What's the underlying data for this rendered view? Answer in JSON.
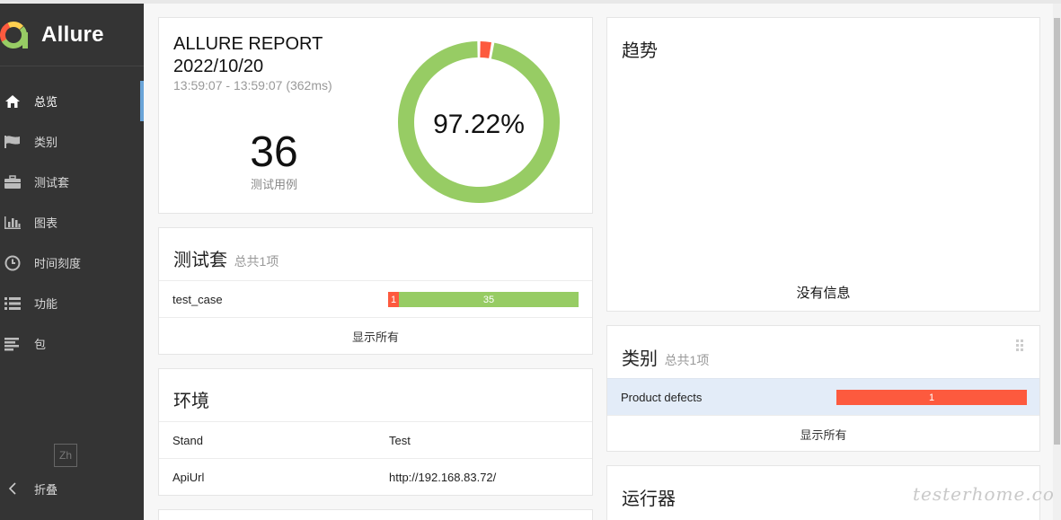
{
  "brand": {
    "name": "Allure"
  },
  "nav": {
    "items": [
      {
        "label": "总览",
        "icon": "home-icon"
      },
      {
        "label": "类别",
        "icon": "flag-icon"
      },
      {
        "label": "测试套",
        "icon": "briefcase-icon"
      },
      {
        "label": "图表",
        "icon": "bar-chart-icon"
      },
      {
        "label": "时间刻度",
        "icon": "clock-icon"
      },
      {
        "label": "功能",
        "icon": "list-icon"
      },
      {
        "label": "包",
        "icon": "align-left-icon"
      }
    ],
    "lang": "Zh",
    "collapse": "折叠"
  },
  "summary": {
    "title": "ALLURE REPORT",
    "date": "2022/10/20",
    "time": "13:59:07 - 13:59:07 (362ms)",
    "count": "36",
    "count_label": "测试用例",
    "percent": "97.22%",
    "passed_fraction": 0.9722,
    "failed_fraction": 0.0278,
    "colors": {
      "passed": "#97cc64",
      "failed": "#fd5a3e"
    }
  },
  "suites": {
    "title": "测试套",
    "subtitle": "总共1项",
    "rows": [
      {
        "name": "test_case",
        "failed": "1",
        "passed": "35"
      }
    ],
    "show_all": "显示所有"
  },
  "environment": {
    "title": "环境",
    "rows": [
      {
        "key": "Stand",
        "value": "Test"
      },
      {
        "key": "ApiUrl",
        "value": "http://192.168.83.72/"
      }
    ]
  },
  "trend": {
    "title": "趋势",
    "empty": "没有信息"
  },
  "categories": {
    "title": "类别",
    "subtitle": "总共1项",
    "rows": [
      {
        "name": "Product defects",
        "count": "1"
      }
    ],
    "show_all": "显示所有"
  },
  "executors": {
    "title": "运行器"
  },
  "watermark": "testerhome.com"
}
